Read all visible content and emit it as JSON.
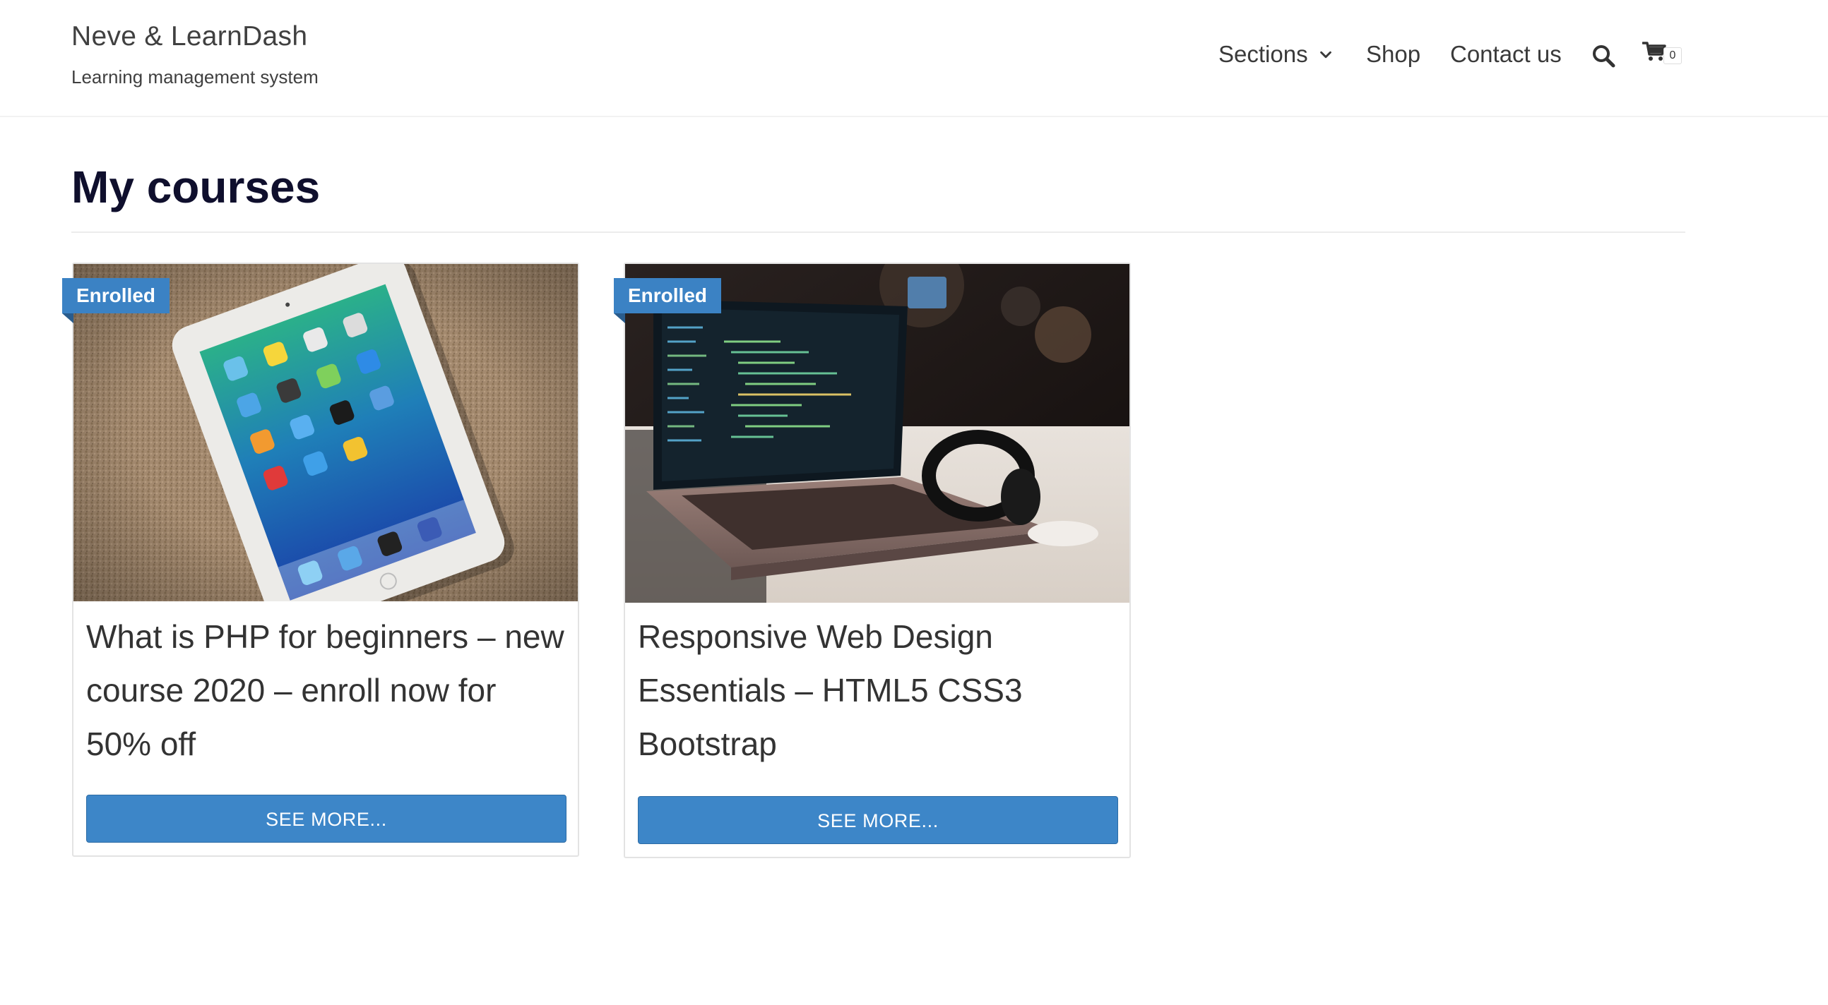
{
  "site": {
    "title": "Neve & LearnDash",
    "tagline": "Learning management system"
  },
  "nav": {
    "items": [
      {
        "label": "Sections",
        "has_dropdown": true
      },
      {
        "label": "Shop"
      },
      {
        "label": "Contact us"
      }
    ],
    "search_icon": "search-icon",
    "cart_icon": "cart-icon",
    "cart_count": "0"
  },
  "page": {
    "title": "My courses"
  },
  "courses": [
    {
      "badge": "Enrolled",
      "title": "What is PHP for beginners – new course 2020 – enroll now for 50% off",
      "button": "SEE MORE...",
      "thumbnail": "tablet on carpet photo"
    },
    {
      "badge": "Enrolled",
      "title": "Responsive Web Design Essentials – HTML5 CSS3 Bootstrap",
      "button": "SEE MORE...",
      "thumbnail": "laptop with code photo"
    }
  ],
  "colors": {
    "accent": "#3d86c8",
    "badge": "#3b82c4",
    "heading": "#0f0f2d",
    "text": "#393939"
  }
}
